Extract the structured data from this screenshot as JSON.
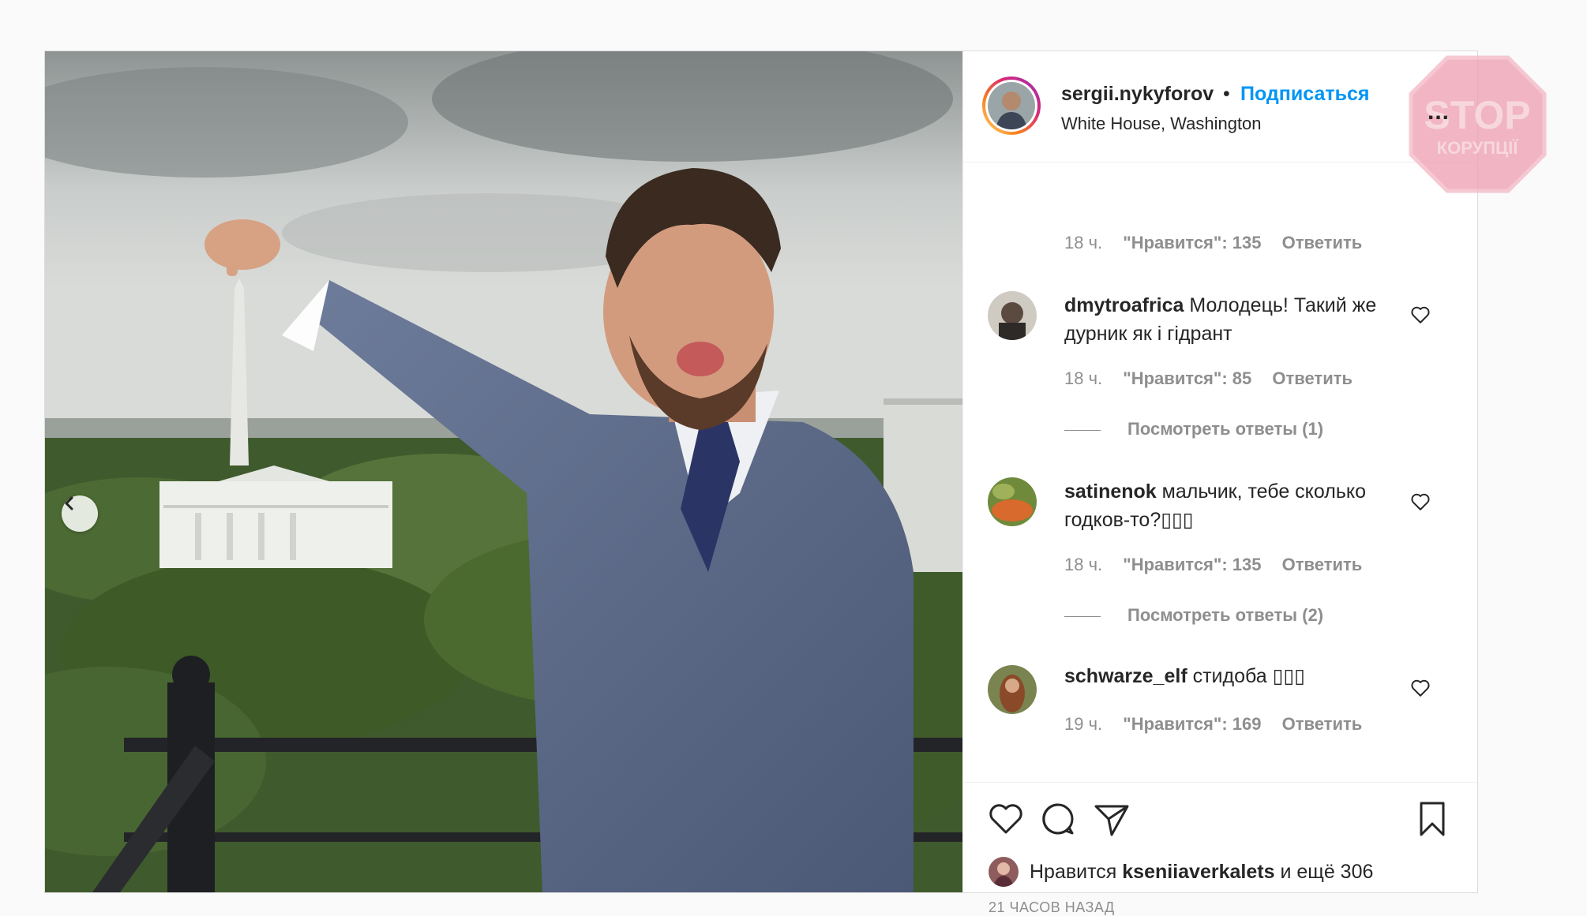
{
  "post": {
    "username": "sergii.nykyforov",
    "separator": "•",
    "follow_label": "Подписаться",
    "location": "White House, Washington",
    "more_label": "...",
    "prev_icon": "chevron-left-icon"
  },
  "watermark": {
    "line1": "STOP",
    "line2": "КОРУПЦІЇ"
  },
  "comments": [
    {
      "meta": {
        "time": "18 ч.",
        "likes": "\"Нравится\": 135",
        "reply": "Ответить"
      }
    },
    {
      "user": "dmytroafrica",
      "text": "Молодець! Такий же дурник як і гідрант",
      "meta": {
        "time": "18 ч.",
        "likes": "\"Нравится\": 85",
        "reply": "Ответить"
      },
      "view_replies": "Посмотреть ответы (1)"
    },
    {
      "user": "satinenok",
      "text": "мальчик, тебе сколько годков-то?▯▯▯",
      "meta": {
        "time": "18 ч.",
        "likes": "\"Нравится\": 135",
        "reply": "Ответить"
      },
      "view_replies": "Посмотреть ответы (2)"
    },
    {
      "user": "schwarze_elf",
      "text": "стидоба ▯▯▯",
      "meta": {
        "time": "19 ч.",
        "likes": "\"Нравится\": 169",
        "reply": "Ответить"
      }
    }
  ],
  "actions": {
    "liked_prefix": "Нравится",
    "liked_user": "kseniiaverkalets",
    "liked_suffix": "и ещё 306",
    "time_ago": "21 ЧАСОВ НАЗАД"
  },
  "colors": {
    "accent": "#0095f6",
    "text": "#262626",
    "muted": "#8e8e8e",
    "stamp": "#e89aa8"
  }
}
